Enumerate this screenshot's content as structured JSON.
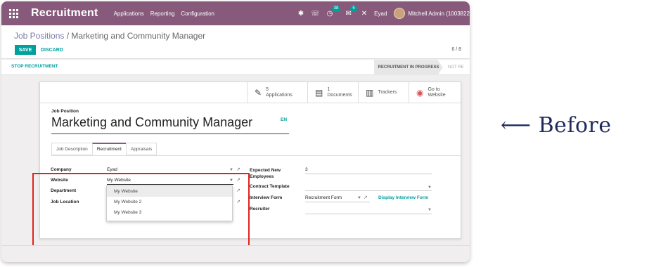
{
  "navbar": {
    "brand": "Recruitment",
    "menu": [
      "Applications",
      "Reporting",
      "Configuration"
    ],
    "badge_chat": "38",
    "badge_activity": "5",
    "company": "Eyad",
    "user": "Mitchell Admin (1003822"
  },
  "control": {
    "breadcrumb_root": "Job Positions",
    "breadcrumb_sep": " / ",
    "breadcrumb_current": "Marketing and Community Manager",
    "save": "SAVE",
    "discard": "DISCARD",
    "pager": "6 / 8"
  },
  "statusbar": {
    "stop_button": "STOP RECRUITMENT",
    "stage_active": "RECRUITMENT IN PROGRESS",
    "stage_next": "NOT RE"
  },
  "smart_buttons": {
    "applications_count": "5",
    "applications_label": "Applications",
    "documents_count": "1",
    "documents_label": "Documents",
    "trackers_label": "Trackers",
    "website_label_1": "Go to",
    "website_label_2": "Website"
  },
  "form": {
    "field_label": "Job Position",
    "title": "Marketing and Community Manager",
    "lang": "EN",
    "tabs": [
      "Job Description",
      "Recruitment",
      "Appraisals"
    ],
    "company_label": "Company",
    "company_value": "Eyad",
    "website_label": "Website",
    "website_value": "My Website",
    "department_label": "Department",
    "location_label": "Job Location",
    "expected_label_1": "Expected New",
    "expected_label_2": "Employees",
    "expected_value": "3",
    "contract_label": "Contract Template",
    "interview_label": "Interview Form",
    "interview_value": "Recruitment Form",
    "interview_link": "Display Interview Form",
    "recruiter_label": "Recruiter"
  },
  "dropdown": {
    "options": [
      "My Website",
      "My Website 2",
      "My Website 3"
    ]
  },
  "annotation": {
    "arrow": "⟵",
    "text": "Before"
  },
  "colors": {
    "navbar": "#875a7b",
    "accent": "#00a09d",
    "highlight_box": "#e0241d"
  }
}
